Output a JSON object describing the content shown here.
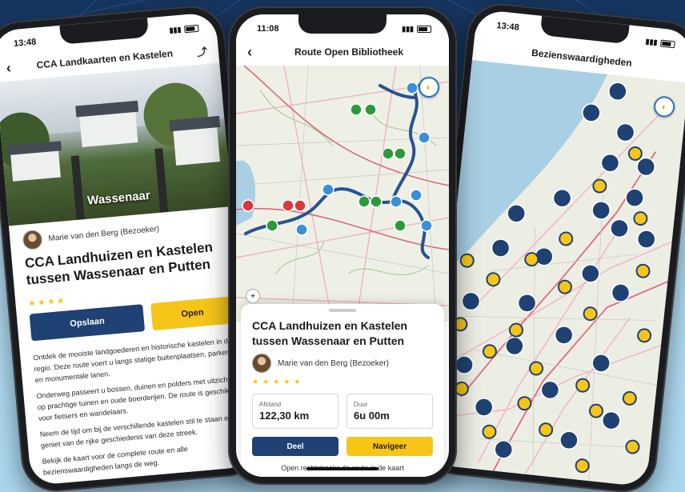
{
  "phones": {
    "left": {
      "status_time": "13:48",
      "title": "CCA Landkaarten en Kastelen",
      "hero_caption": "Wassenaar",
      "author": "Marie van den Berg (Bezoeker)",
      "article_title": "CCA Landhuizen en Kastelen tussen Wassenaar en Putten",
      "rating": 4,
      "btn_primary": "Opslaan",
      "btn_secondary": "Open",
      "paragraphs": [
        "Ontdek de mooiste landgoederen en historische kastelen in de regio. Deze route voert u langs statige buitenplaatsen, parken en monumentale lanen.",
        "Onderweg passeert u bossen, duinen en polders met uitzicht op prachtige tuinen en oude boerderijen. De route is geschikt voor fietsers en wandelaars.",
        "Neem de tijd om bij de verschillende kastelen stil te staan en geniet van de rijke geschiedenis van deze streek.",
        "Bekijk de kaart voor de complete route en alle bezienswaardigheden langs de weg."
      ]
    },
    "mid": {
      "status_time": "11:08",
      "title": "Route Open Bibliotheek",
      "sheet_title": "CCA Landhuizen en Kastelen tussen Wassenaar en Putten",
      "author": "Marie van den Berg (Bezoeker)",
      "rating": 5,
      "stat1_label": "Afstand",
      "stat1_value": "122,30 km",
      "stat2_label": "Duur",
      "stat2_value": "6u 00m",
      "btn_primary": "Deel",
      "btn_secondary": "Navigeer",
      "footer": "Open rechtstreeks de route in de kaart"
    },
    "right": {
      "status_time": "13:48",
      "title": "Bezienswaardigheden"
    }
  },
  "colors": {
    "navy": "#1f4173",
    "yellow": "#f6c518",
    "route": "#27538f",
    "sea": "#a9cfe4"
  },
  "icons": [
    "back-arrow-icon",
    "share-icon",
    "star-icon",
    "compass-icon",
    "locate-icon",
    "map-pin-icon"
  ]
}
